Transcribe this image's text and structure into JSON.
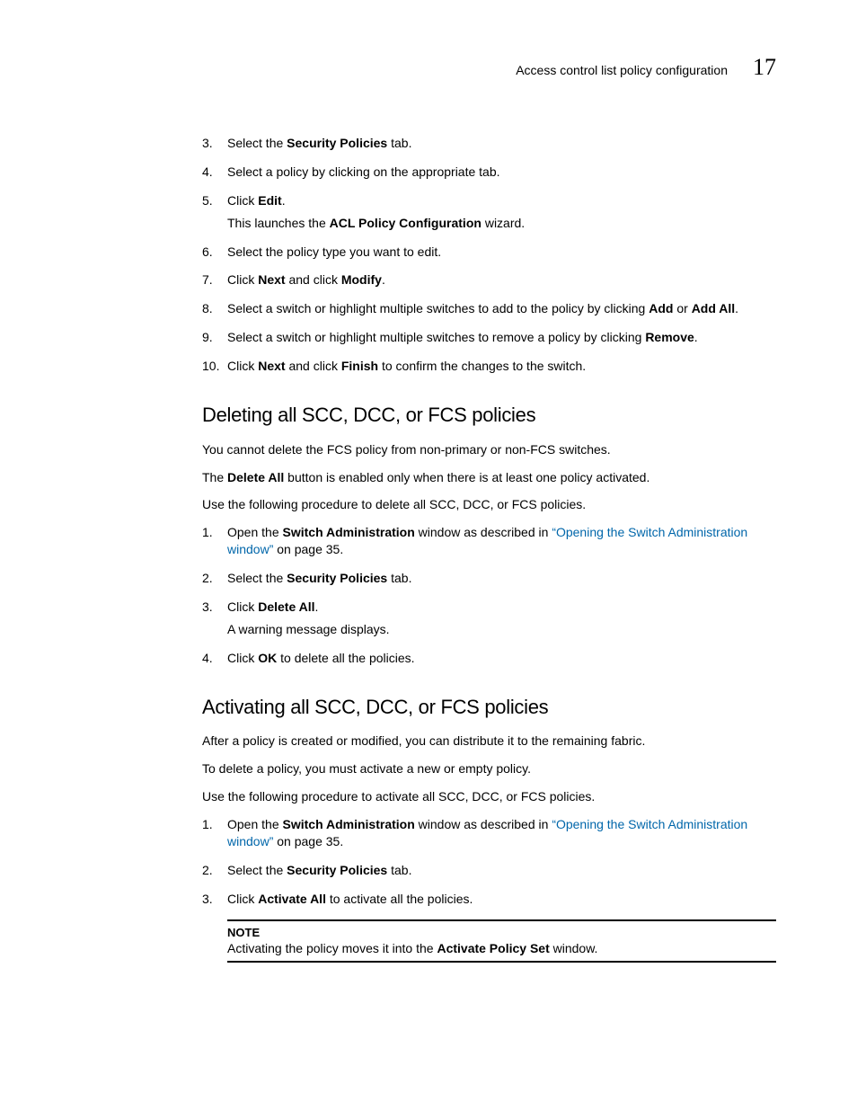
{
  "header": {
    "title": "Access control list policy configuration",
    "page_number": "17"
  },
  "top_steps": [
    {
      "n": "3.",
      "parts": [
        "Select the ",
        {
          "b": "Security Policies"
        },
        " tab."
      ]
    },
    {
      "n": "4.",
      "parts": [
        "Select a policy by clicking on the appropriate tab."
      ]
    },
    {
      "n": "5.",
      "parts": [
        "Click ",
        {
          "b": "Edit"
        },
        "."
      ],
      "sub": [
        "This launches the ",
        {
          "b": "ACL Policy Configuration"
        },
        " wizard."
      ]
    },
    {
      "n": "6.",
      "parts": [
        "Select the policy type you want to edit."
      ]
    },
    {
      "n": "7.",
      "parts": [
        "Click ",
        {
          "b": "Next"
        },
        " and click ",
        {
          "b": "Modify"
        },
        "."
      ]
    },
    {
      "n": "8.",
      "parts": [
        "Select a switch or highlight multiple switches to add to the policy by clicking ",
        {
          "b": "Add"
        },
        " or ",
        {
          "b": "Add All"
        },
        "."
      ]
    },
    {
      "n": "9.",
      "parts": [
        "Select a switch or highlight multiple switches to remove a policy by clicking ",
        {
          "b": "Remove"
        },
        "."
      ]
    },
    {
      "n": "10.",
      "parts": [
        "Click ",
        {
          "b": "Next"
        },
        " and click ",
        {
          "b": "Finish"
        },
        " to confirm the changes to the switch."
      ]
    }
  ],
  "section_delete": {
    "heading": "Deleting all SCC, DCC, or FCS policies",
    "paras": [
      [
        "You cannot delete the FCS policy from non-primary or non-FCS switches."
      ],
      [
        "The ",
        {
          "b": "Delete All"
        },
        " button is enabled only when there is at least one policy activated."
      ],
      [
        "Use the following procedure to delete all SCC, DCC, or FCS policies."
      ]
    ],
    "steps": [
      {
        "n": "1.",
        "parts": [
          "Open the ",
          {
            "b": "Switch Administration"
          },
          " window as described in ",
          {
            "a": "“Opening the Switch Administration window”"
          },
          " on page 35."
        ]
      },
      {
        "n": "2.",
        "parts": [
          "Select the ",
          {
            "b": "Security Policies"
          },
          " tab."
        ]
      },
      {
        "n": "3.",
        "parts": [
          "Click ",
          {
            "b": "Delete All"
          },
          "."
        ],
        "sub": [
          "A warning message displays."
        ]
      },
      {
        "n": "4.",
        "parts": [
          "Click ",
          {
            "b": "OK"
          },
          " to delete all the policies."
        ]
      }
    ]
  },
  "section_activate": {
    "heading": "Activating all SCC, DCC, or FCS policies",
    "paras": [
      [
        "After a policy is created or modified, you can distribute it to the remaining fabric."
      ],
      [
        "To delete a policy, you must activate a new or empty policy."
      ],
      [
        "Use the following procedure to activate all SCC, DCC, or FCS policies."
      ]
    ],
    "steps": [
      {
        "n": "1.",
        "parts": [
          "Open the ",
          {
            "b": "Switch Administration"
          },
          " window as described in ",
          {
            "a": "“Opening the Switch Administration window”"
          },
          " on page 35."
        ]
      },
      {
        "n": "2.",
        "parts": [
          "Select the ",
          {
            "b": "Security Policies"
          },
          " tab."
        ]
      },
      {
        "n": "3.",
        "parts": [
          "Click ",
          {
            "b": "Activate All"
          },
          " to activate all the policies."
        ]
      }
    ],
    "note": {
      "label": "NOTE",
      "body": [
        "Activating the policy moves it into the ",
        {
          "b": "Activate Policy Set"
        },
        " window."
      ]
    }
  }
}
